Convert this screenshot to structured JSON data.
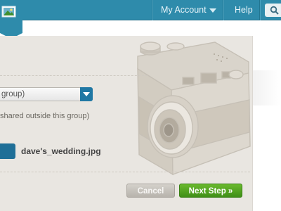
{
  "nav": {
    "account_label": "My Account",
    "help_label": "Help"
  },
  "form": {
    "select_value": "group)",
    "hint_text": "shared outside this group)",
    "file_name": "dave's_wedding.jpg"
  },
  "actions": {
    "cancel_label": "Cancel",
    "next_label": "Next Step »"
  },
  "colors": {
    "topbar": "#2e8bab",
    "panel": "#e9e6e1",
    "select_arrow": "#2078a4",
    "next_button": "#4fa220",
    "cancel_button": "#c7c3bc"
  },
  "icons": {
    "logo": "photo-icon",
    "account_menu": "chevron-down-icon",
    "search": "search-icon",
    "select": "chevron-down-icon",
    "illustration": "camera-illustration"
  }
}
